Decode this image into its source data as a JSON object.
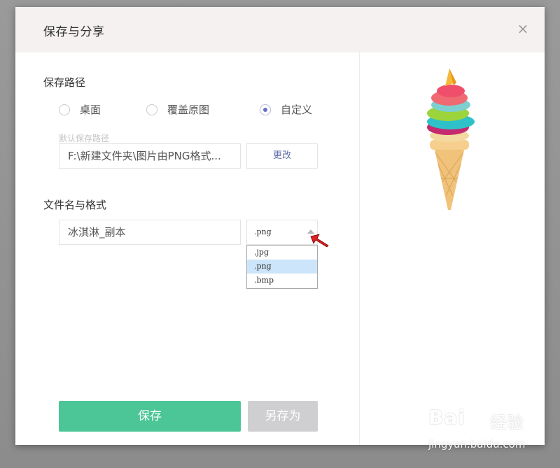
{
  "dialog": {
    "title": "保存与分享",
    "close_glyph": "×"
  },
  "save_path": {
    "label": "保存路径",
    "options": [
      {
        "label": "桌面",
        "checked": false
      },
      {
        "label": "覆盖原图",
        "checked": false
      },
      {
        "label": "自定义",
        "checked": true
      }
    ],
    "hint": "默认保存路径",
    "path_value": "F:\\新建文件夹\\图片由PNG格式...",
    "change_button": "更改"
  },
  "file_format": {
    "label": "文件名与格式",
    "filename_value": "冰淇淋_副本",
    "selected_format": ".png",
    "options": [
      ".jpg",
      ".png",
      ".bmp"
    ]
  },
  "actions": {
    "save": "保存",
    "save_as": "另存为"
  },
  "watermark": {
    "logo": "Bai",
    "logo_suffix": "经验",
    "url": "jingyan.baidu.com"
  },
  "colors": {
    "primary": "#4cc597",
    "disabled": "#cfcfd2",
    "header_bg": "#f4f1f0",
    "radio_checked": "#6a6fc7",
    "pointer": "#e02020"
  },
  "icons": [
    "close-icon",
    "chevron-up-icon",
    "red-arrow-pointer-icon",
    "ice-cream-image"
  ]
}
